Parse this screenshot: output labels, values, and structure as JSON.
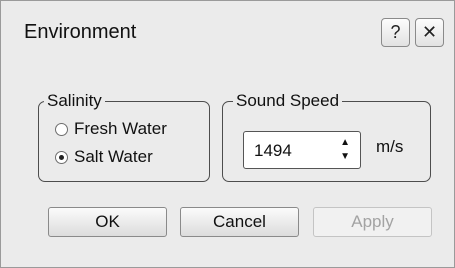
{
  "window": {
    "title": "Environment",
    "help_label": "?",
    "close_label": "✕"
  },
  "salinity": {
    "legend": "Salinity",
    "options": [
      {
        "label": "Fresh Water",
        "checked": false
      },
      {
        "label": "Salt Water",
        "checked": true
      }
    ]
  },
  "sound_speed": {
    "legend": "Sound Speed",
    "value": "1494",
    "unit": "m/s",
    "up_icon": "▲",
    "down_icon": "▼"
  },
  "buttons": {
    "ok": "OK",
    "cancel": "Cancel",
    "apply": "Apply",
    "apply_enabled": false
  }
}
